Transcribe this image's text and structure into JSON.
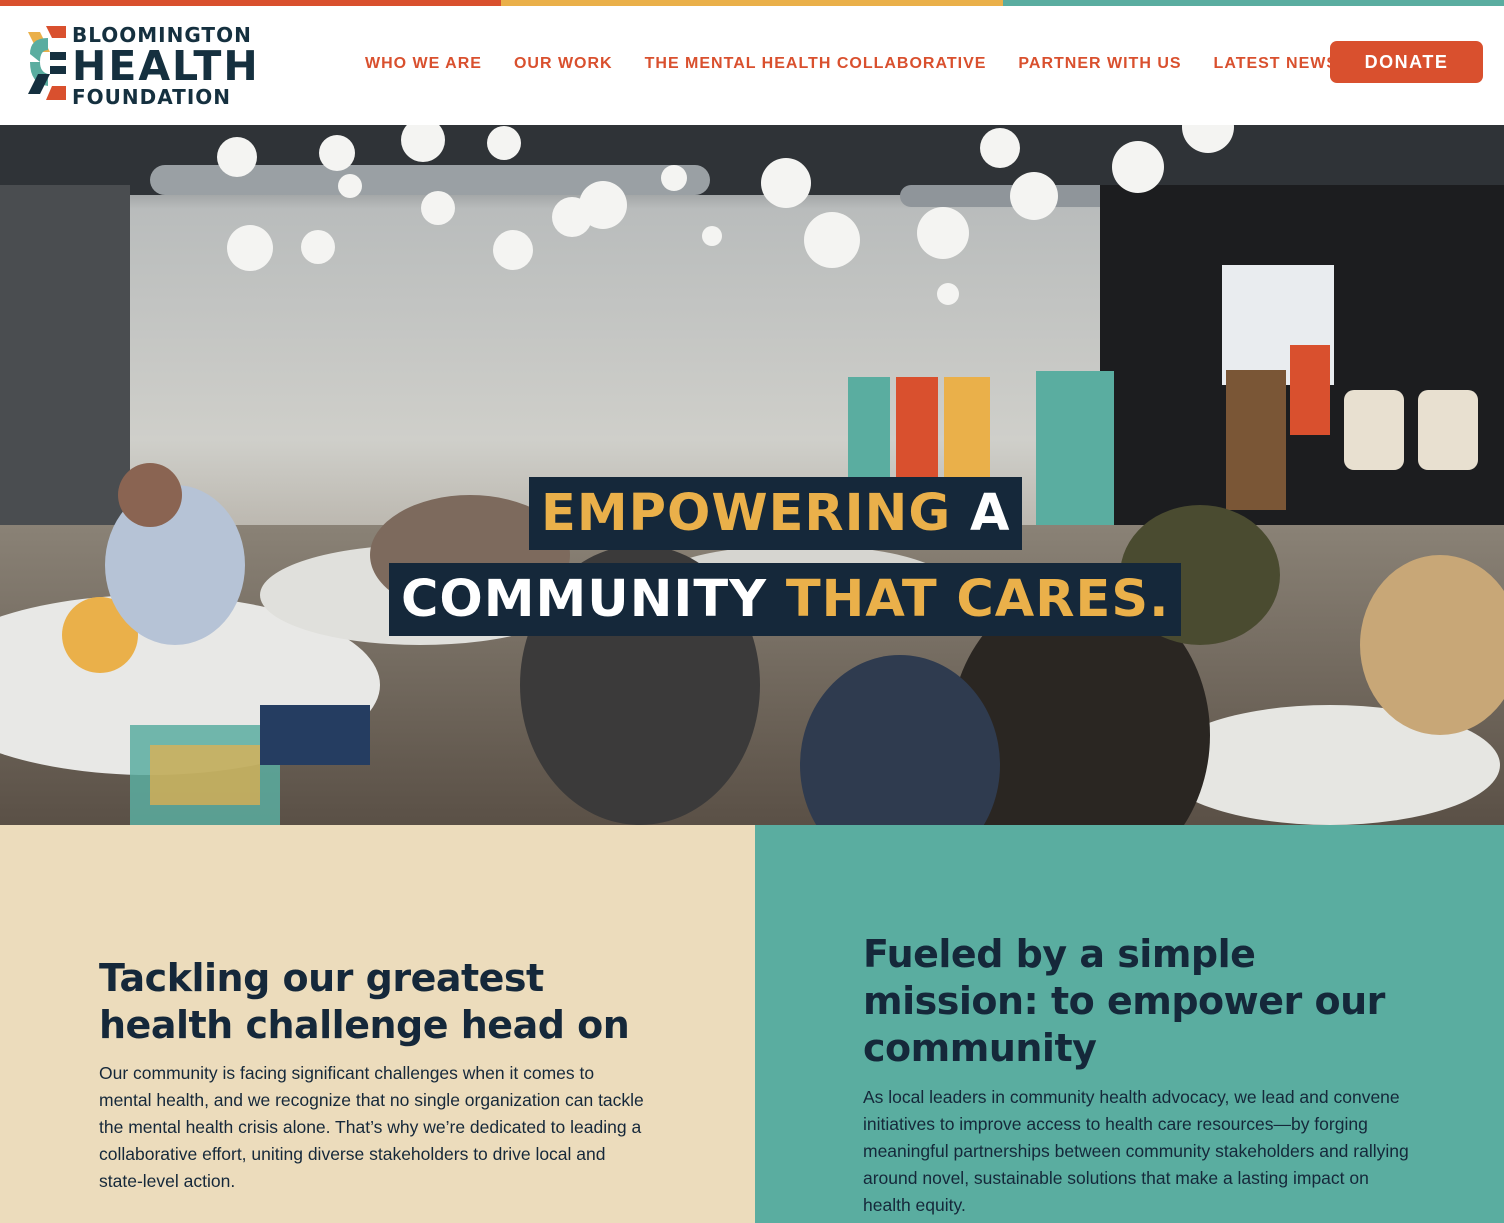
{
  "brand": {
    "line1": "BLOOMINGTON",
    "line2": "HEALTH",
    "line3": "FOUNDATION",
    "colors": {
      "orange": "#d9502e",
      "gold": "#eab04a",
      "teal": "#5aada0",
      "navy": "#15283a",
      "sand": "#ecdcbc"
    }
  },
  "nav": {
    "items": [
      {
        "label": "WHO WE ARE"
      },
      {
        "label": "OUR WORK"
      },
      {
        "label": "THE MENTAL HEALTH COLLABORATIVE"
      },
      {
        "label": "PARTNER WITH US"
      },
      {
        "label": "LATEST NEWS"
      }
    ],
    "donate_label": "DONATE"
  },
  "hero": {
    "line1_highlight": "EMPOWERING",
    "line1_rest": " A",
    "line2_plain": "COMMUNITY ",
    "line2_highlight": "THAT CARES."
  },
  "left": {
    "heading": "Tackling our greatest health challenge head on",
    "body": "Our community is facing significant challenges when it comes to mental health, and we recognize that no single organization can tackle the mental health crisis alone. That’s why we’re dedicated to leading a collaborative effort, uniting diverse stakeholders to drive local and state-level action."
  },
  "right": {
    "heading": "Fueled by a simple mission: to empower our community",
    "body": "As local leaders in community health advocacy, we lead and convene initiatives to improve access to health care resources—by forging meaningful partnerships between community stakeholders and rallying around novel, sustainable solutions that make a lasting impact on health equity."
  }
}
